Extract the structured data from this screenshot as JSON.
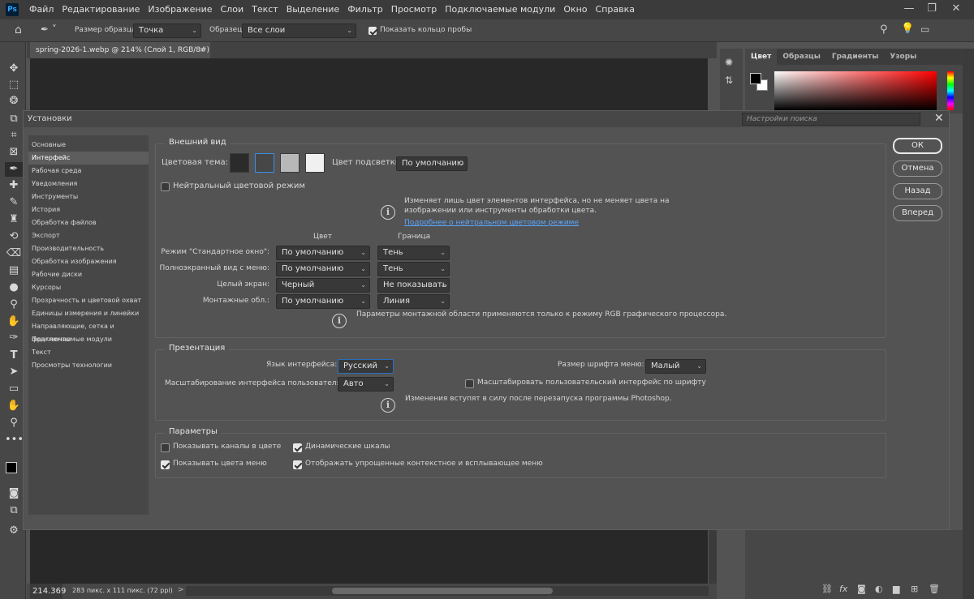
{
  "menubar": {
    "logo": "Ps",
    "items": [
      "Файл",
      "Редактирование",
      "Изображение",
      "Слои",
      "Текст",
      "Выделение",
      "Фильтр",
      "Просмотр",
      "Подключаемые модули",
      "Окно",
      "Справка"
    ]
  },
  "options": {
    "sample_size_label": "Размер образца:",
    "sample_size_value": "Точка",
    "sample_label": "Образец:",
    "sample_value": "Все слои",
    "show_ring_label": "Показать кольцо пробы",
    "show_ring_checked": true
  },
  "doc": {
    "tab_title": "spring-2026-1.webp @ 214% (Слой 1, RGB/8#)",
    "zoom": "214.369",
    "size_info": "283 пикс. x 111 пикс. (72 ppi)"
  },
  "color_panel": {
    "tabs": [
      "Цвет",
      "Образцы",
      "Градиенты",
      "Узоры"
    ]
  },
  "dialog": {
    "title": "Установки",
    "search_placeholder": "Настройки поиска",
    "categories": [
      "Основные",
      "Интерфейс",
      "Рабочая среда",
      "Уведомления",
      "Инструменты",
      "История",
      "Обработка файлов",
      "Экспорт",
      "Производительность",
      "Обработка изображения",
      "Рабочие диски",
      "Курсоры",
      "Прозрачность и цветовой охват",
      "Единицы измерения и линейки",
      "Направляющие, сетка и фрагменты",
      "Подключаемые модули",
      "Текст",
      "Просмотры технологии"
    ],
    "selected_category": 1,
    "buttons": {
      "ok": "ОК",
      "cancel": "Отмена",
      "back": "Назад",
      "forward": "Вперед"
    },
    "appearance": {
      "title": "Внешний вид",
      "theme_label": "Цветовая тема:",
      "theme_colors": [
        "#2b2b2b",
        "#474747",
        "#b8b8b8",
        "#f0f0f0"
      ],
      "selected_theme": 1,
      "highlight_label": "Цвет подсветки:",
      "highlight_value": "По умолчанию",
      "neutral_label": "Нейтральный цветовой режим",
      "neutral_info": "Изменяет лишь цвет элементов интерфейса, но не меняет цвета на изображении или инструменты обработки цвета.",
      "neutral_info_line1": "Изменяет лишь цвет элементов интерфейса, но не меняет цвета на",
      "neutral_info_line2": "изображении или инструменты обработки цвета.",
      "neutral_link": "Подробнее о нейтральном цветовом режиме",
      "col_color": "Цвет",
      "col_border": "Граница",
      "rows": [
        {
          "label": "Режим \"Стандартное окно\":",
          "color": "По умолчанию",
          "border": "Тень"
        },
        {
          "label": "Полноэкранный вид с меню:",
          "color": "По умолчанию",
          "border": "Тень"
        },
        {
          "label": "Целый экран:",
          "color": "Черный",
          "border": "Не показывать"
        },
        {
          "label": "Монтажные обл.:",
          "color": "По умолчанию",
          "border": "Линия"
        }
      ],
      "artboard_info": "Параметры монтажной области применяются только к режиму RGB графического процессора."
    },
    "presentation": {
      "title": "Презентация",
      "lang_label": "Язык интерфейса:",
      "lang_value": "Русский",
      "font_size_label": "Размер шрифта меню:",
      "font_size_value": "Малый",
      "scale_label": "Масштабирование интерфейса пользователя:",
      "scale_value": "Авто",
      "scale_by_font_label": "Масштабировать пользовательский интерфейс по шрифту",
      "restart_info": "Изменения вступят в силу после перезапуска программы Photoshop."
    },
    "params": {
      "title": "Параметры",
      "channels_color": "Показывать каналы в цвете",
      "dynamic_sliders": "Динамические шкалы",
      "menu_colors": "Показывать цвета меню",
      "simplified_menus": "Отображать упрощенные контекстное и всплывающее меню"
    }
  }
}
